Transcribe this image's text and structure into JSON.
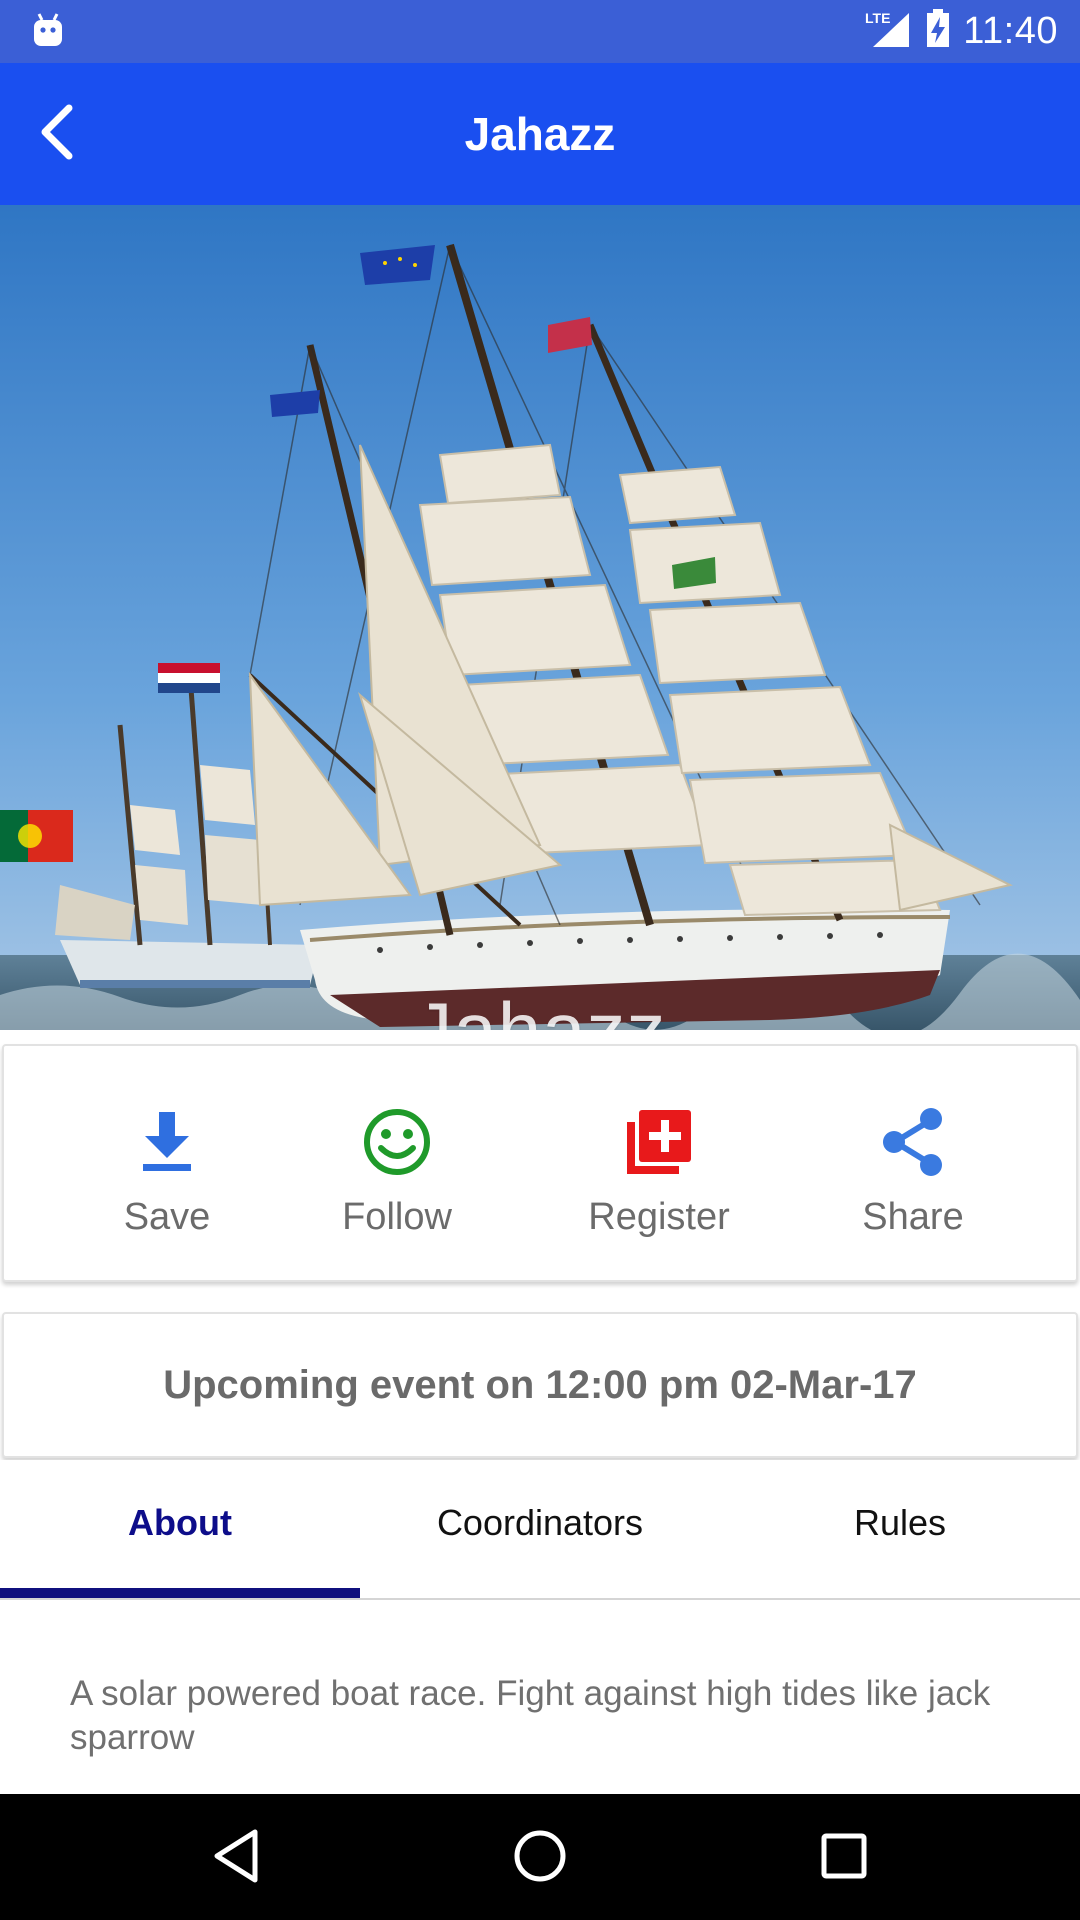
{
  "status_bar": {
    "time": "11:40",
    "network": "LTE",
    "icons": [
      "android-icon",
      "lte-signal-icon",
      "battery-charging-icon"
    ]
  },
  "app_bar": {
    "title": "Jahazz",
    "back_icon": "chevron-left-icon"
  },
  "hero": {
    "title": "Jahazz",
    "image": "tall-ship-photo"
  },
  "actions": [
    {
      "label": "Save",
      "icon": "download-icon",
      "color": "#2f6fe0"
    },
    {
      "label": "Follow",
      "icon": "smiley-icon",
      "color": "#1f9a2a"
    },
    {
      "label": "Register",
      "icon": "add-to-list-icon",
      "color": "#e8191b"
    },
    {
      "label": "Share",
      "icon": "share-icon",
      "color": "#3a7ae0"
    }
  ],
  "event": {
    "text": "Upcoming event on 12:00 pm 02-Mar-17"
  },
  "tabs": [
    {
      "label": "About",
      "active": true
    },
    {
      "label": "Coordinators",
      "active": false
    },
    {
      "label": "Rules",
      "active": false
    }
  ],
  "about": {
    "text": "A solar powered boat race. Fight against high tides like jack sparrow"
  },
  "colors": {
    "status_bar": "#3b5fd6",
    "app_bar": "#1a4ff0",
    "active_tab": "#10107e"
  },
  "nav_bar": {
    "buttons": [
      "back-triangle-icon",
      "home-circle-icon",
      "recents-square-icon"
    ]
  }
}
